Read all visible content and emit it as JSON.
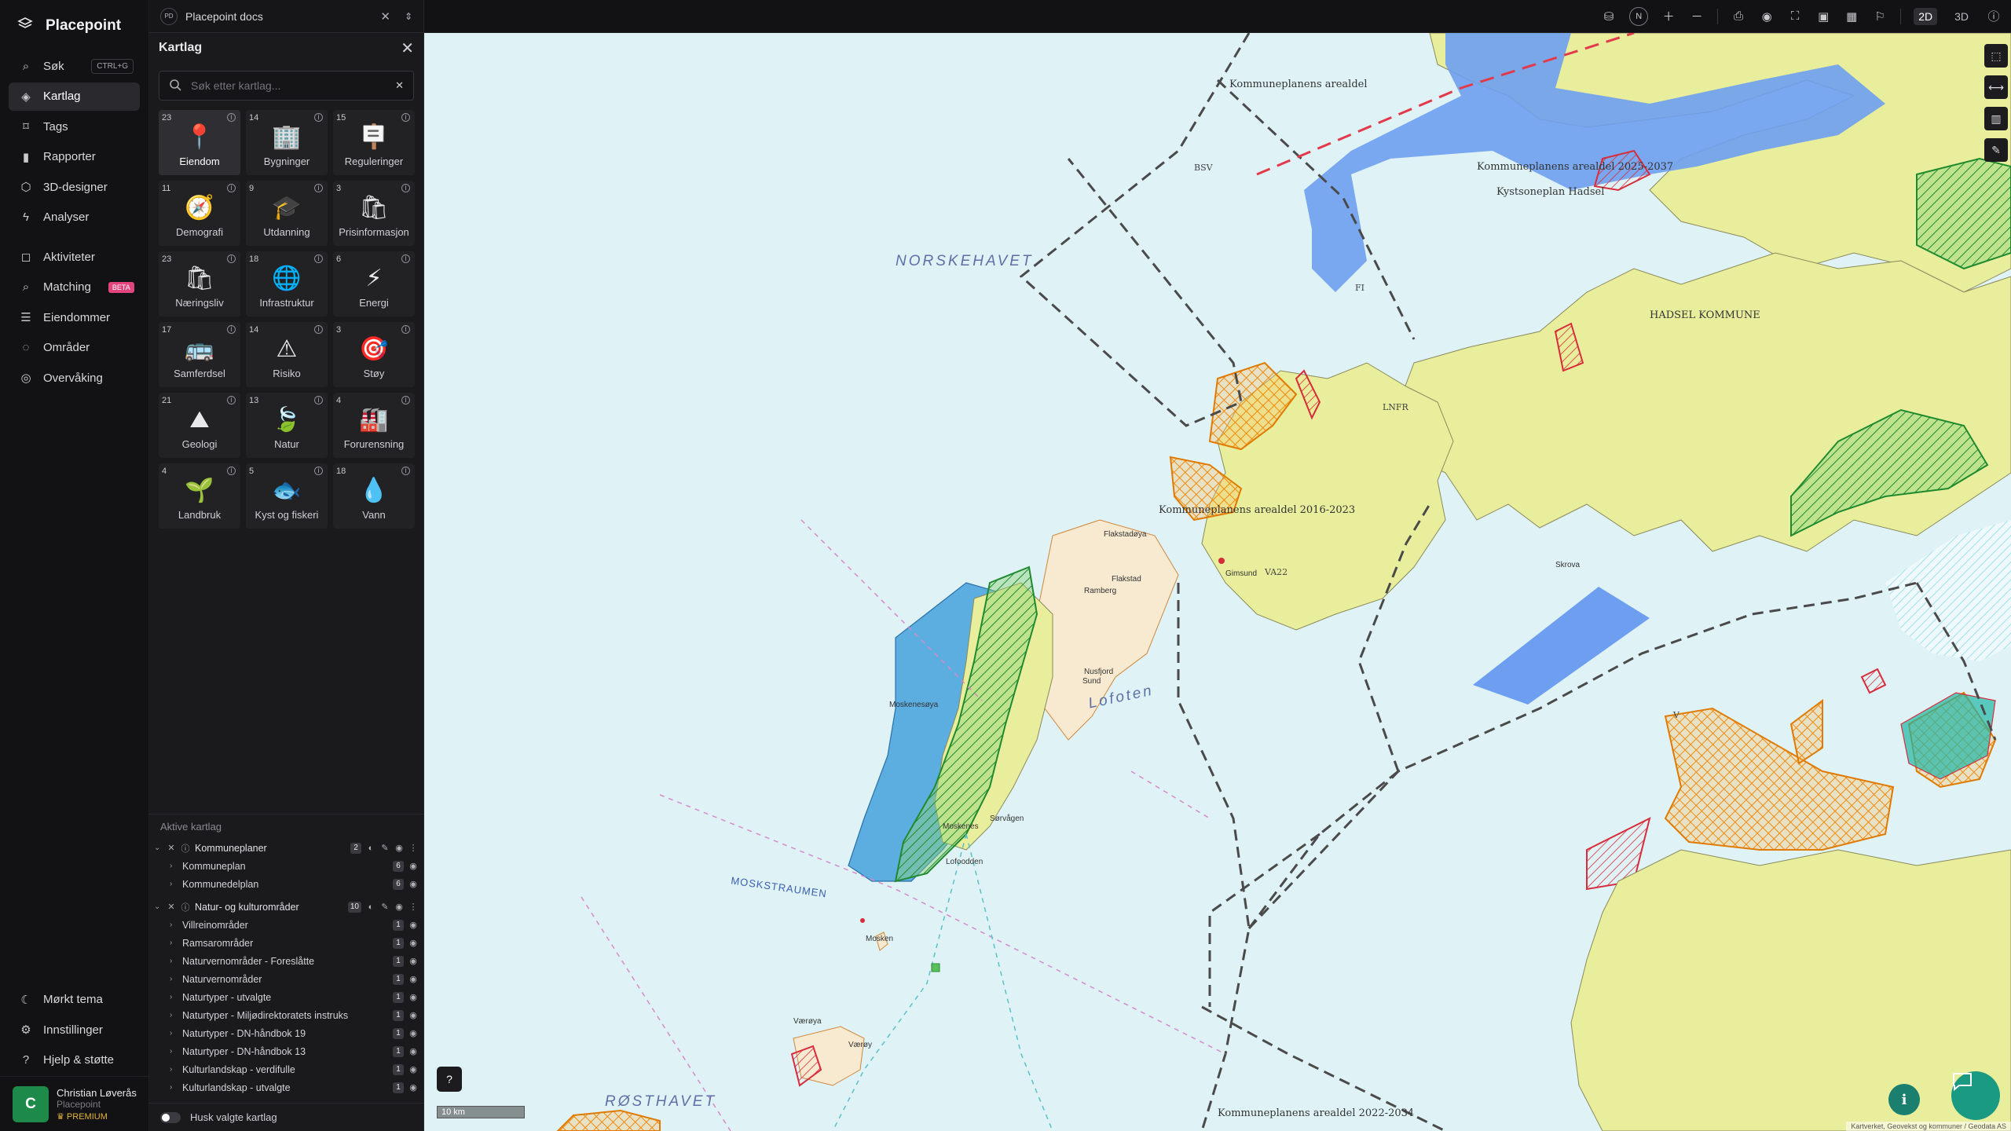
{
  "brand": {
    "name": "Placepoint"
  },
  "nav": {
    "items": [
      {
        "key": "sok",
        "label": "Søk",
        "icon": "search-icon",
        "shortcut": "CTRL+G"
      },
      {
        "key": "kartlag",
        "label": "Kartlag",
        "icon": "layers-icon",
        "active": true
      },
      {
        "key": "tags",
        "label": "Tags",
        "icon": "bookmark-icon"
      },
      {
        "key": "rapporter",
        "label": "Rapporter",
        "icon": "chart-icon"
      },
      {
        "key": "3d",
        "label": "3D-designer",
        "icon": "cube-icon"
      },
      {
        "key": "analyser",
        "label": "Analyser",
        "icon": "bolt-icon"
      }
    ],
    "items2": [
      {
        "key": "aktiviteter",
        "label": "Aktiviteter",
        "icon": "chat-icon"
      },
      {
        "key": "matching",
        "label": "Matching",
        "icon": "search-plus-icon",
        "badge": "BETA"
      },
      {
        "key": "eiendommer",
        "label": "Eiendommer",
        "icon": "document-icon"
      },
      {
        "key": "omrader",
        "label": "Områder",
        "icon": "area-icon"
      },
      {
        "key": "overvaking",
        "label": "Overvåking",
        "icon": "monitor-icon"
      }
    ],
    "bottom": [
      {
        "key": "dark",
        "label": "Mørkt tema",
        "icon": "moon-icon"
      },
      {
        "key": "settings",
        "label": "Innstillinger",
        "icon": "gear-icon"
      },
      {
        "key": "help",
        "label": "Hjelp & støtte",
        "icon": "help-icon"
      }
    ],
    "user": {
      "initial": "C",
      "name": "Christian Løverås",
      "org": "Placepoint",
      "plan": "PREMIUM"
    }
  },
  "panel": {
    "doc_badge": "PD",
    "doc_title": "Placepoint docs",
    "title": "Kartlag",
    "search_placeholder": "Søk etter kartlag...",
    "categories": [
      {
        "count": "23",
        "label": "Eiendom",
        "glyph": "📍",
        "selected": true
      },
      {
        "count": "14",
        "label": "Bygninger",
        "glyph": "🏢"
      },
      {
        "count": "15",
        "label": "Reguleringer",
        "glyph": "🪧"
      },
      {
        "count": "11",
        "label": "Demografi",
        "glyph": "🧭"
      },
      {
        "count": "9",
        "label": "Utdanning",
        "glyph": "🎓"
      },
      {
        "count": "3",
        "label": "Prisinformasjon",
        "glyph": "🛍"
      },
      {
        "count": "23",
        "label": "Næringsliv",
        "glyph": "🛍"
      },
      {
        "count": "18",
        "label": "Infrastruktur",
        "glyph": "🌐"
      },
      {
        "count": "6",
        "label": "Energi",
        "glyph": "⚡"
      },
      {
        "count": "17",
        "label": "Samferdsel",
        "glyph": "🚌"
      },
      {
        "count": "14",
        "label": "Risiko",
        "glyph": "⚠"
      },
      {
        "count": "3",
        "label": "Støy",
        "glyph": "🎯"
      },
      {
        "count": "21",
        "label": "Geologi",
        "glyph": "⛰"
      },
      {
        "count": "13",
        "label": "Natur",
        "glyph": "🍃"
      },
      {
        "count": "4",
        "label": "Forurensning",
        "glyph": "🏭"
      },
      {
        "count": "4",
        "label": "Landbruk",
        "glyph": "🌱"
      },
      {
        "count": "5",
        "label": "Kyst og fiskeri",
        "glyph": "🐟"
      },
      {
        "count": "18",
        "label": "Vann",
        "glyph": "💧"
      }
    ],
    "active_title": "Aktive kartlag",
    "groups": [
      {
        "name": "Kommuneplaner",
        "count": "2",
        "children": [
          {
            "name": "Kommuneplan",
            "count": "6"
          },
          {
            "name": "Kommunedelplan",
            "count": "6"
          }
        ]
      },
      {
        "name": "Natur- og kulturområder",
        "count": "10",
        "children": [
          {
            "name": "Villreinområder",
            "count": "1"
          },
          {
            "name": "Ramsarområder",
            "count": "1"
          },
          {
            "name": "Naturvernområder - Foreslåtte",
            "count": "1"
          },
          {
            "name": "Naturvernområder",
            "count": "1"
          },
          {
            "name": "Naturtyper - utvalgte",
            "count": "1"
          },
          {
            "name": "Naturtyper - Miljødirektoratets instruks",
            "count": "1"
          },
          {
            "name": "Naturtyper - DN-håndbok 19",
            "count": "1"
          },
          {
            "name": "Naturtyper - DN-håndbok 13",
            "count": "1"
          },
          {
            "name": "Kulturlandskap - verdifulle",
            "count": "1"
          },
          {
            "name": "Kulturlandskap - utvalgte",
            "count": "1"
          }
        ]
      }
    ],
    "remember_label": "Husk valgte kartlag"
  },
  "topbar": {
    "compass": "N",
    "mode_2d": "2D",
    "mode_3d": "3D",
    "active_mode": "2D"
  },
  "map": {
    "labels": [
      {
        "text": "NORSKEHAVET",
        "kind": "sea"
      },
      {
        "text": "Lofoten",
        "kind": "sea"
      },
      {
        "text": "MOSKSTRAUMEN",
        "kind": "strait"
      },
      {
        "text": "RØSTHAVET",
        "kind": "sea"
      },
      {
        "text": "Kommuneplanens arealdel",
        "kind": "plan"
      },
      {
        "text": "Kommuneplanens arealdel 2025-2037",
        "kind": "plan"
      },
      {
        "text": "Kommuneplanens arealdel 2016-2023",
        "kind": "plan"
      },
      {
        "text": "Kommuneplanens arealdel 2022-2034",
        "kind": "plan"
      },
      {
        "text": "Kystsoneplan Hadsel",
        "kind": "plan"
      },
      {
        "text": "HADSEL KOMMUNE",
        "kind": "plan"
      },
      {
        "text": "BSV",
        "kind": "zone"
      },
      {
        "text": "FI",
        "kind": "zone"
      },
      {
        "text": "LNFR",
        "kind": "zone"
      },
      {
        "text": "V",
        "kind": "zone"
      },
      {
        "text": "VA22",
        "kind": "zone"
      },
      {
        "text": "Flakstadøya",
        "kind": "place"
      },
      {
        "text": "Flakstad",
        "kind": "place"
      },
      {
        "text": "Ramberg",
        "kind": "place"
      },
      {
        "text": "Nusfjord",
        "kind": "place"
      },
      {
        "text": "Sund",
        "kind": "place"
      },
      {
        "text": "Moskenesøya",
        "kind": "place"
      },
      {
        "text": "Moskenes",
        "kind": "place"
      },
      {
        "text": "Sørvågen",
        "kind": "place"
      },
      {
        "text": "Lofoodden",
        "kind": "place"
      },
      {
        "text": "Mosken",
        "kind": "place"
      },
      {
        "text": "Værøya",
        "kind": "place"
      },
      {
        "text": "Værøy",
        "kind": "place"
      },
      {
        "text": "Skrova",
        "kind": "place"
      },
      {
        "text": "Gimsund",
        "kind": "place"
      }
    ],
    "scale": "10 km",
    "attribution": "Kartverket, Geovekst og kommuner / Geodata AS"
  },
  "colors": {
    "sea": "#dff3f6",
    "land": "#e8ee9c",
    "water_zone": "#6e9ef0",
    "hatch_orange": "#f39a1a",
    "hatch_green": "#2f9e3f",
    "hatch_red": "#d92c3a",
    "accent_teal": "#1a9a82"
  }
}
